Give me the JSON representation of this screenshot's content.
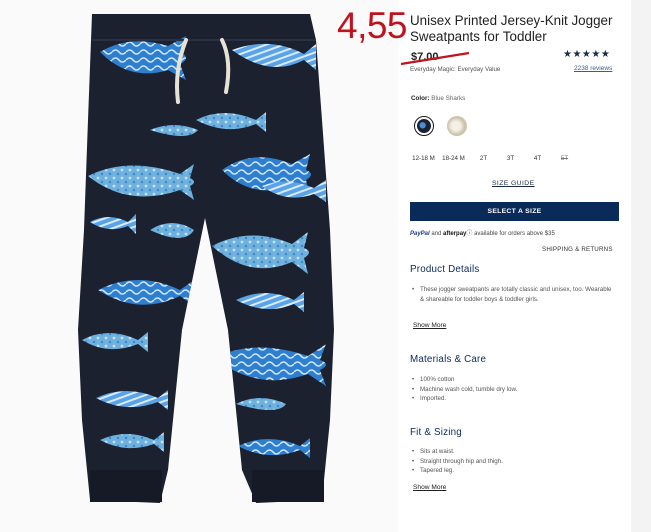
{
  "overlay_price": "4,55",
  "product": {
    "title": "Unisex Printed Jersey-Knit Jogger Sweatpants for Toddler",
    "old_price": "$7.00",
    "price_note": "Everyday Magic: Everyday Value",
    "rating_stars": "★★★★★",
    "reviews": "2238 reviews"
  },
  "color": {
    "label": "Color:",
    "value": "Blue Sharks",
    "swatches": [
      "blue-sharks",
      "cream-print"
    ]
  },
  "sizes": [
    "12-18 M",
    "18-24 M",
    "2T",
    "3T",
    "4T",
    "5T"
  ],
  "size_guide": "SIZE GUIDE",
  "select_button": "SELECT A SIZE",
  "payment": {
    "paypal": "PayPal",
    "and": "and",
    "afterpay": "afterpay",
    "note": "available for orders above $35"
  },
  "shipping": "SHIPPING & RETURNS",
  "sections": {
    "details": {
      "heading": "Product Details",
      "items": [
        "These jogger sweatpants are totally classic and unisex, too. Wearable & shareable for toddler boys & toddler girls."
      ],
      "show_more": "Show More"
    },
    "materials": {
      "heading": "Materials & Care",
      "items": [
        "100% cotton",
        "Machine wash cold, tumble dry low.",
        "Imported."
      ]
    },
    "fit": {
      "heading": "Fit & Sizing",
      "items": [
        "Sits at waist.",
        "Straight through hip and thigh.",
        "Tapered leg."
      ],
      "show_more": "Show More"
    }
  },
  "colors": {
    "navy": "#1c2130",
    "shark_blue": "#2f7fd0",
    "brand": "#0a2a5a",
    "overlay_red": "#c0121f"
  }
}
